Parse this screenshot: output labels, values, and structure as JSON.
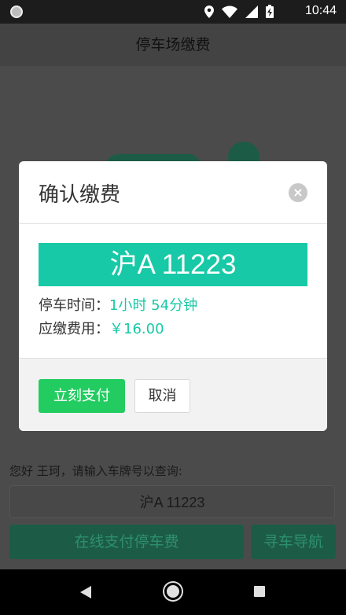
{
  "status_bar": {
    "time": "10:44",
    "icons": [
      "location-icon",
      "wifi-icon",
      "signal-icon",
      "battery-charging-icon"
    ]
  },
  "app_bar": {
    "title": "停车场缴费"
  },
  "background": {
    "prompt": "您好 王珂，请输入车牌号以查询:",
    "plate_input_value": "沪A 11223",
    "pay_online_label": "在线支付停车费",
    "find_car_label": "寻车导航"
  },
  "dialog": {
    "title": "确认缴费",
    "close_icon": "close-icon",
    "plate": "沪A 11223",
    "duration_label": "停车时间：",
    "duration_value": "1小时 54分钟",
    "fee_label": "应缴费用：",
    "fee_value": "￥16.00",
    "pay_now_label": "立刻支付",
    "cancel_label": "取消"
  },
  "colors": {
    "accent": "#17c9a6",
    "pay_button": "#23cc61"
  }
}
